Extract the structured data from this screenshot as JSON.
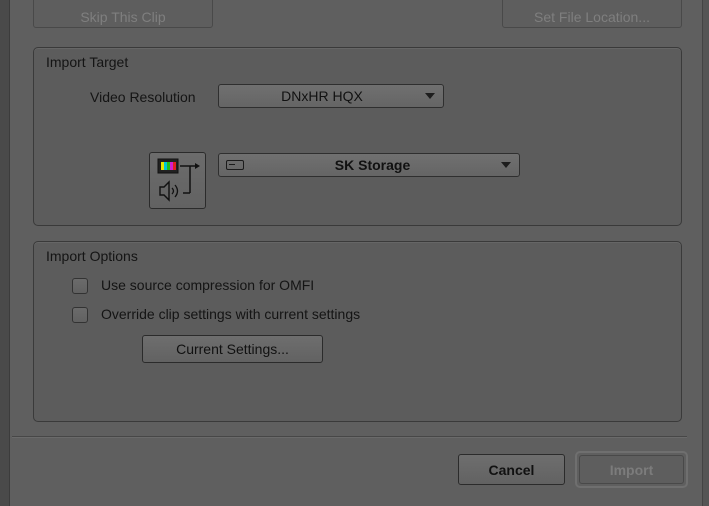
{
  "top_buttons": {
    "skip_clip": "Skip This Clip",
    "set_file_location": "Set File Location..."
  },
  "import_target": {
    "title": "Import Target",
    "video_resolution_label": "Video Resolution",
    "video_resolution_value": "DNxHR HQX",
    "storage_value": "SK Storage",
    "media_routing_icon": "video-audio-routing-icon",
    "drive_icon": "drive-icon"
  },
  "import_options": {
    "title": "Import Options",
    "use_source_compression": {
      "label": "Use source compression for OMFI",
      "checked": false
    },
    "override_clip_settings": {
      "label": "Override clip settings with current settings",
      "checked": false
    },
    "current_settings_button": "Current Settings..."
  },
  "footer": {
    "cancel_label": "Cancel",
    "import_label": "Import"
  }
}
